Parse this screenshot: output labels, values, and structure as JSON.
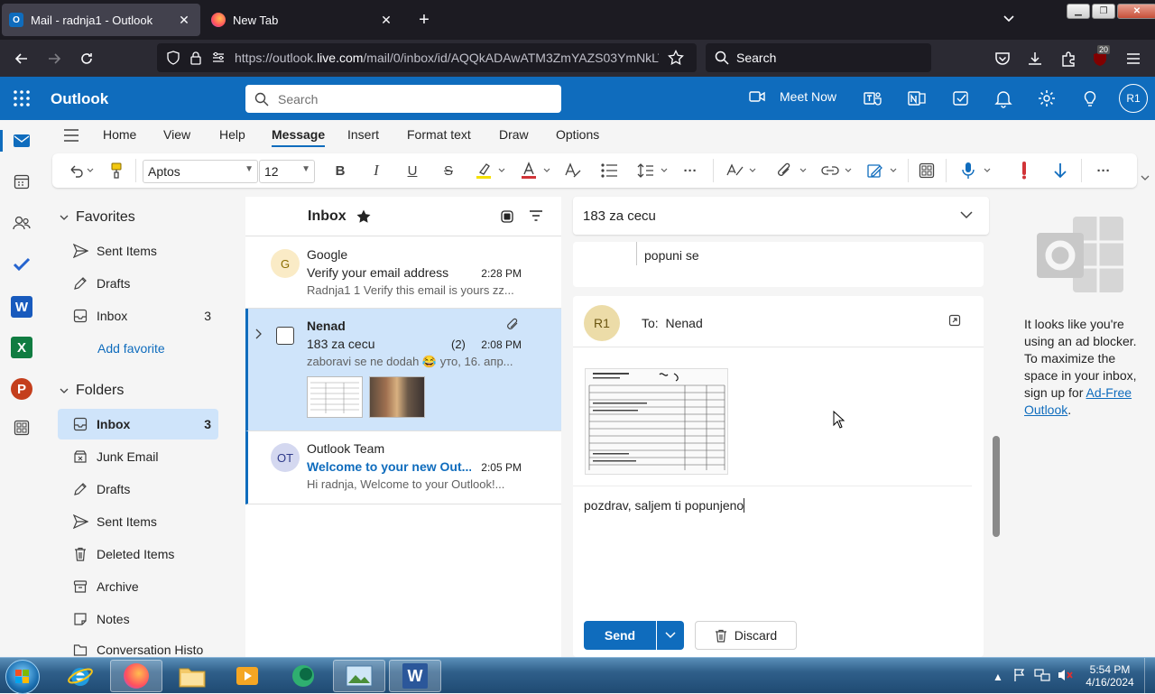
{
  "browser": {
    "tabs": [
      {
        "title": "Mail - radnja1 - Outlook",
        "active": true
      },
      {
        "title": "New Tab",
        "active": false
      }
    ],
    "url_prefix": "https://outlook.",
    "url_domain": "live.com",
    "url_rest": "/mail/0/inbox/id/AQQkADAwATM3ZmYAZS03YmNkLTEx",
    "search_placeholder": "Search",
    "extension_badge": "20"
  },
  "header": {
    "brand": "Outlook",
    "search_placeholder": "Search",
    "meet_now": "Meet Now",
    "avatar": "R1",
    "accent": "#0f6cbd"
  },
  "ribbon": {
    "tabs": [
      "Home",
      "View",
      "Help",
      "Message",
      "Insert",
      "Format text",
      "Draw",
      "Options"
    ],
    "selected_tab": "Message",
    "font_name": "Aptos",
    "font_size": "12"
  },
  "folders": {
    "favorites_label": "Favorites",
    "favorites": [
      {
        "label": "Sent Items",
        "icon": "send-icon",
        "count": ""
      },
      {
        "label": "Drafts",
        "icon": "pencil-icon",
        "count": ""
      },
      {
        "label": "Inbox",
        "icon": "inbox-icon",
        "count": "3"
      }
    ],
    "add_favorite": "Add favorite",
    "folders_label": "Folders",
    "items": [
      {
        "label": "Inbox",
        "icon": "inbox-icon",
        "count": "3",
        "selected": true
      },
      {
        "label": "Junk Email",
        "icon": "junk-icon",
        "count": ""
      },
      {
        "label": "Drafts",
        "icon": "pencil-icon",
        "count": ""
      },
      {
        "label": "Sent Items",
        "icon": "send-icon",
        "count": ""
      },
      {
        "label": "Deleted Items",
        "icon": "trash-icon",
        "count": ""
      },
      {
        "label": "Archive",
        "icon": "archive-icon",
        "count": ""
      },
      {
        "label": "Notes",
        "icon": "note-icon",
        "count": ""
      },
      {
        "label": "Conversation Histo",
        "icon": "folder-icon",
        "count": ""
      }
    ]
  },
  "message_list": {
    "title": "Inbox",
    "messages": [
      {
        "avatar": "G",
        "sender": "Google",
        "subject": "Verify your email address",
        "time": "2:28 PM",
        "preview": "Radnja1 1 Verify this email is yours zz..."
      },
      {
        "avatar": "",
        "sender": "Nenad",
        "subject": "183 za cecu",
        "count": "(2)",
        "time": "2:08 PM",
        "preview": "zaboravi se ne dodah 😂 уто, 16. апр..."
      },
      {
        "avatar": "OT",
        "sender": "Outlook Team",
        "subject": "Welcome to your new Out...",
        "time": "2:05 PM",
        "preview": "Hi radnja, Welcome to your Outlook!..."
      }
    ]
  },
  "reading": {
    "subject": "183 za cecu",
    "prev_message_text": "popuni se",
    "compose_avatar": "R1",
    "to_label": "To:",
    "to_value": "Nenad",
    "body": "pozdrav, saljem ti popunjeno",
    "send_label": "Send",
    "discard_label": "Discard"
  },
  "ad_pane": {
    "text_before": "It looks like you're using an ad blocker. To maximize the space in your inbox, sign up for ",
    "link": "Ad-Free Outlook",
    "text_after": "."
  },
  "taskbar": {
    "time": "5:54 PM",
    "date": "4/16/2024"
  }
}
